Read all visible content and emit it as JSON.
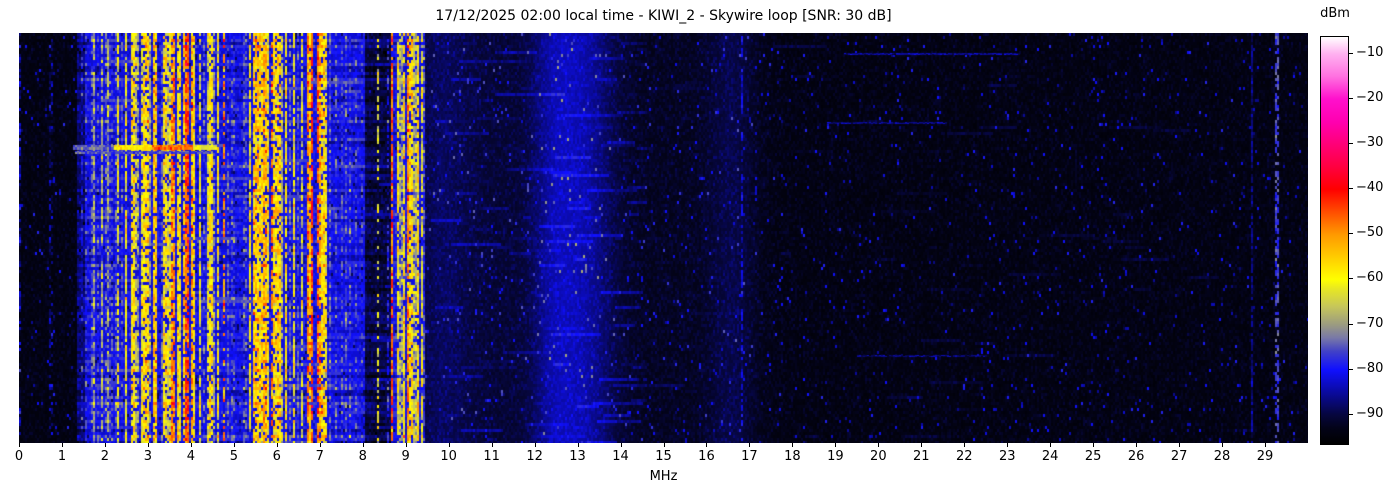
{
  "title": "17/12/2025 02:00 local time - KIWI_2 - Skywire loop [SNR: 30 dB]",
  "xlabel": "MHz",
  "x_ticks": [
    "0",
    "1",
    "2",
    "3",
    "4",
    "5",
    "6",
    "7",
    "8",
    "9",
    "10",
    "11",
    "12",
    "13",
    "14",
    "15",
    "16",
    "17",
    "18",
    "19",
    "20",
    "21",
    "22",
    "23",
    "24",
    "25",
    "26",
    "27",
    "28",
    "29"
  ],
  "x_tick_values": [
    0,
    1,
    2,
    3,
    4,
    5,
    6,
    7,
    8,
    9,
    10,
    11,
    12,
    13,
    14,
    15,
    16,
    17,
    18,
    19,
    20,
    21,
    22,
    23,
    24,
    25,
    26,
    27,
    28,
    29
  ],
  "colorbar": {
    "label": "dBm",
    "tick_labels": [
      "−10",
      "−20",
      "−30",
      "−40",
      "−50",
      "−60",
      "−70",
      "−80",
      "−90"
    ],
    "tick_values": [
      -10,
      -20,
      -30,
      -40,
      -50,
      -60,
      -70,
      -80,
      -90
    ],
    "value_top": -6.2,
    "value_bottom": -96.5
  },
  "chart_data": {
    "type": "heatmap",
    "title": "17/12/2025 02:00 local time - KIWI_2 - Skywire loop [SNR: 30 dB]",
    "xlabel": "MHz",
    "value_unit": "dBm",
    "x_range": [
      0,
      30
    ],
    "value_range": [
      -96.5,
      -6
    ],
    "background_level": -95,
    "description": "HF waterfall spectrogram: strong shortwave/broadcast activity 1.4-9.5 MHz (yellow/orange/red vertical stripes), diffuse blue noise around 10-14 MHz peaking near 13 MHz, faint speckle above 17 MHz, dashed carrier near 29.25 MHz, lightning/burst horizontal streak near one-quarter height spanning 1.3-4.6 MHz",
    "colormap_stops": [
      [
        -96.5,
        "#000000"
      ],
      [
        -93,
        "#030318"
      ],
      [
        -90,
        "#06063e"
      ],
      [
        -85,
        "#0a0aa0"
      ],
      [
        -80,
        "#1010ff"
      ],
      [
        -76,
        "#4040c8"
      ],
      [
        -73,
        "#7878a8"
      ],
      [
        -70,
        "#9b9b80"
      ],
      [
        -66,
        "#c6c65a"
      ],
      [
        -62,
        "#e8e822"
      ],
      [
        -60,
        "#ffff00"
      ],
      [
        -55,
        "#ffcc00"
      ],
      [
        -50,
        "#ff9900"
      ],
      [
        -45,
        "#ff4d00"
      ],
      [
        -40,
        "#ff0000"
      ],
      [
        -35,
        "#ff0040"
      ],
      [
        -30,
        "#ff0077"
      ],
      [
        -25,
        "#ff00b0"
      ],
      [
        -20,
        "#ff10cc"
      ],
      [
        -15,
        "#ff70e0"
      ],
      [
        -10,
        "#ffb0f0"
      ],
      [
        -6,
        "#ffffff"
      ]
    ],
    "floors": [
      [
        1.35,
        1.55,
        -89
      ],
      [
        1.55,
        8.05,
        -83
      ],
      [
        8.05,
        8.65,
        -92
      ],
      [
        8.65,
        9.45,
        -83
      ]
    ],
    "bands": [
      [
        0.0,
        0.05,
        -85,
        0.5
      ],
      [
        0.72,
        0.77,
        -87,
        0.6
      ],
      [
        1.42,
        1.47,
        -81,
        0.4
      ],
      [
        1.54,
        1.58,
        -79
      ],
      [
        1.67,
        1.72,
        -77
      ],
      [
        1.73,
        1.76,
        -70
      ],
      [
        1.8,
        1.86,
        -79
      ],
      [
        1.92,
        1.95,
        -68
      ],
      [
        1.98,
        2.05,
        -76
      ],
      [
        2.06,
        2.09,
        -70
      ],
      [
        2.1,
        2.17,
        -78
      ],
      [
        2.22,
        2.26,
        -77
      ],
      [
        2.3,
        2.34,
        -62
      ],
      [
        2.38,
        2.42,
        -78
      ],
      [
        2.46,
        2.52,
        -60
      ],
      [
        2.54,
        2.58,
        -70
      ],
      [
        2.6,
        2.68,
        -58
      ],
      [
        2.7,
        2.74,
        -66
      ],
      [
        2.75,
        2.78,
        -70
      ],
      [
        2.84,
        2.88,
        -62
      ],
      [
        2.9,
        3.02,
        -57
      ],
      [
        3.04,
        3.08,
        -70
      ],
      [
        3.1,
        3.22,
        -55
      ],
      [
        3.24,
        3.28,
        -62
      ],
      [
        3.3,
        3.34,
        -76
      ],
      [
        3.36,
        3.44,
        -58
      ],
      [
        3.46,
        3.52,
        -63
      ],
      [
        3.55,
        3.65,
        -50
      ],
      [
        3.67,
        3.72,
        -57
      ],
      [
        3.74,
        3.78,
        -62
      ],
      [
        3.8,
        3.86,
        -55
      ],
      [
        3.88,
        3.97,
        -45
      ],
      [
        3.99,
        4.03,
        -52
      ],
      [
        4.05,
        4.1,
        -58
      ],
      [
        4.12,
        4.16,
        -75
      ],
      [
        4.2,
        4.24,
        -62
      ],
      [
        4.28,
        4.34,
        -77
      ],
      [
        4.38,
        4.42,
        -63
      ],
      [
        4.44,
        4.5,
        -58
      ],
      [
        4.52,
        4.56,
        -72
      ],
      [
        4.6,
        4.66,
        -60
      ],
      [
        4.68,
        4.72,
        -70
      ],
      [
        4.76,
        4.8,
        -50,
        0.5
      ],
      [
        4.84,
        4.9,
        -77
      ],
      [
        4.95,
        5.05,
        -78
      ],
      [
        5.1,
        5.14,
        -80
      ],
      [
        5.22,
        5.3,
        -77
      ],
      [
        5.35,
        5.42,
        -60
      ],
      [
        5.44,
        5.58,
        -55
      ],
      [
        5.6,
        5.68,
        -57
      ],
      [
        5.7,
        5.76,
        -53
      ],
      [
        5.78,
        5.84,
        -60
      ],
      [
        5.86,
        5.9,
        -48,
        0.45
      ],
      [
        5.92,
        6.0,
        -58
      ],
      [
        6.02,
        6.1,
        -56
      ],
      [
        6.12,
        6.16,
        -68
      ],
      [
        6.18,
        6.26,
        -58
      ],
      [
        6.28,
        6.34,
        -75
      ],
      [
        6.36,
        6.42,
        -60
      ],
      [
        6.46,
        6.52,
        -77
      ],
      [
        6.56,
        6.62,
        -63
      ],
      [
        6.68,
        6.75,
        -48
      ],
      [
        6.76,
        6.8,
        -55
      ],
      [
        6.81,
        6.86,
        -44
      ],
      [
        6.87,
        6.91,
        -40
      ],
      [
        6.92,
        6.96,
        -47
      ],
      [
        6.97,
        7.02,
        -52
      ],
      [
        7.04,
        7.1,
        -57
      ],
      [
        7.12,
        7.18,
        -60
      ],
      [
        7.22,
        7.26,
        -76
      ],
      [
        7.3,
        7.33,
        -62
      ],
      [
        7.36,
        7.42,
        -77
      ],
      [
        7.48,
        7.54,
        -78
      ],
      [
        7.58,
        7.62,
        -76
      ],
      [
        7.68,
        7.74,
        -77
      ],
      [
        7.8,
        7.86,
        -78
      ],
      [
        7.95,
        7.99,
        -80
      ],
      [
        8.03,
        8.07,
        -52,
        0.5
      ],
      [
        8.33,
        8.36,
        -64,
        0.55
      ],
      [
        8.55,
        8.59,
        -80,
        0.45
      ],
      [
        8.68,
        8.72,
        -46
      ],
      [
        8.78,
        8.84,
        -60
      ],
      [
        8.86,
        8.92,
        -70
      ],
      [
        8.94,
        9.0,
        -58
      ],
      [
        9.03,
        9.08,
        -50
      ],
      [
        9.1,
        9.16,
        -57
      ],
      [
        9.18,
        9.24,
        -68
      ],
      [
        9.26,
        9.32,
        -58
      ],
      [
        9.34,
        9.4,
        -62
      ],
      [
        9.42,
        9.46,
        -77
      ]
    ],
    "diffuse": [
      {
        "c": 9.8,
        "s": 0.5,
        "b": 3.0
      },
      {
        "c": 11.0,
        "s": 1.6,
        "b": 3.0
      },
      {
        "c": 12.4,
        "s": 0.35,
        "b": 4.0
      },
      {
        "c": 13.1,
        "s": 0.55,
        "b": 7.5
      },
      {
        "c": 15.3,
        "s": 1.2,
        "b": 1.5
      },
      {
        "c": 16.6,
        "s": 0.4,
        "b": 3.5
      }
    ],
    "dash_columns": [
      {
        "f": 16.82,
        "w": 0.06,
        "level": -82,
        "p": 0.5
      },
      {
        "f": 28.68,
        "w": 0.05,
        "level": -87,
        "p": 0.85
      },
      {
        "f": 29.27,
        "w": 0.07,
        "level": -76,
        "p": 0.55
      }
    ],
    "events": [
      {
        "y": 112,
        "h": 5,
        "segs": [
          [
            1.25,
            2.2,
            -74
          ],
          [
            2.2,
            3.1,
            -58
          ],
          [
            3.1,
            4.05,
            -47
          ],
          [
            4.05,
            4.6,
            -62
          ]
        ]
      },
      {
        "y": 118,
        "h": 3,
        "segs": [
          [
            1.3,
            4.5,
            -76
          ]
        ]
      },
      {
        "y": 20,
        "h": 2,
        "segs": [
          [
            19.2,
            23.3,
            -86
          ]
        ]
      },
      {
        "y": 89,
        "h": 2,
        "segs": [
          [
            18.8,
            21.6,
            -87
          ]
        ]
      },
      {
        "y": 322,
        "h": 2,
        "segs": [
          [
            19.5,
            22.5,
            -88
          ]
        ]
      }
    ],
    "texture_dashes": [
      {
        "count": 110,
        "f0": 1.55,
        "f1": 9.45,
        "bmin": 4,
        "bmax": 8
      },
      {
        "count": 90,
        "f0": 9.45,
        "f1": 14.6,
        "bmin": 3,
        "bmax": 7
      },
      {
        "count": 40,
        "f0": 14.6,
        "f1": 28.6,
        "bmin": 2.5,
        "bmax": 5
      }
    ]
  }
}
